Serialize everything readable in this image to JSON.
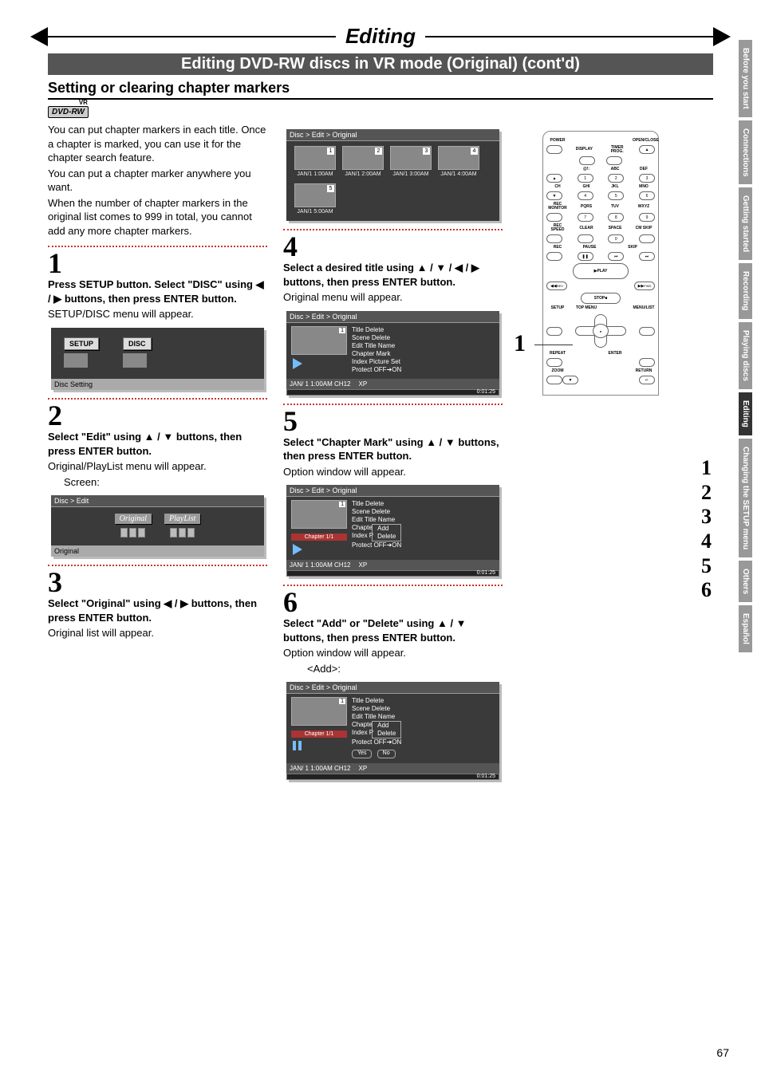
{
  "header": {
    "title": "Editing",
    "subtitle": "Editing DVD-RW discs in VR mode (Original) (cont'd)",
    "section": "Setting or clearing chapter markers",
    "badge": "DVD-RW",
    "badge_vr": "VR"
  },
  "intro": {
    "p1": "You can put chapter markers in each title. Once a chapter is marked, you can use it for the chapter search feature.",
    "p2": "You can put a chapter marker anywhere you want.",
    "p3": "When the number of chapter markers in the original list comes to 999 in total, you cannot add any more chapter markers."
  },
  "steps": {
    "s1": {
      "num": "1",
      "title": "Press SETUP button. Select \"DISC\" using ◀ / ▶ buttons, then press ENTER button.",
      "body": "SETUP/DISC menu will appear."
    },
    "s2": {
      "num": "2",
      "title": "Select \"Edit\" using ▲ / ▼ buttons, then press ENTER button.",
      "body": "Original/PlayList menu will appear.",
      "body2": "Screen:"
    },
    "s3": {
      "num": "3",
      "title": "Select \"Original\" using ◀ / ▶ buttons, then press ENTER button.",
      "body": "Original list will appear."
    },
    "s4": {
      "num": "4",
      "title": "Select a desired title using ▲ / ▼ / ◀ / ▶ buttons, then press ENTER button.",
      "body": "Original menu will appear."
    },
    "s5": {
      "num": "5",
      "title": "Select \"Chapter Mark\" using ▲ / ▼ buttons, then press ENTER button.",
      "body": "Option window will appear."
    },
    "s6": {
      "num": "6",
      "title": "Select \"Add\" or \"Delete\" using ▲ / ▼ buttons, then press ENTER button.",
      "body": "Option window will appear.",
      "body2": "<Add>:"
    }
  },
  "screens": {
    "setup": {
      "btn1": "SETUP",
      "btn2": "DISC",
      "footer": "Disc Setting"
    },
    "edit": {
      "title": "Disc > Edit",
      "opt1": "Original",
      "opt2": "PlayList",
      "footer": "Original"
    },
    "orig_list": {
      "title": "Disc > Edit > Original",
      "thumbs": [
        {
          "num": "1",
          "label": "JAN/1   1:00AM"
        },
        {
          "num": "2",
          "label": "JAN/1   2:00AM"
        },
        {
          "num": "3",
          "label": "JAN/1   3:00AM"
        },
        {
          "num": "4",
          "label": "JAN/1   4:00AM"
        },
        {
          "num": "5",
          "label": "JAN/1   5:00AM"
        }
      ]
    },
    "orig_menu": {
      "title": "Disc > Edit > Original",
      "items": [
        "Title Delete",
        "Scene Delete",
        "Edit Title Name",
        "Chapter Mark",
        "Index Picture Set",
        "Protect OFF➔ON"
      ],
      "status_date": "JAN/ 1   1:00AM  CH12",
      "status_mode": "XP",
      "time": "0:01:25",
      "thumb_num": "1"
    },
    "chapter_menu": {
      "title": "Disc > Edit > Original",
      "chapter": "Chapter 1/1",
      "items_pre": [
        "Title Delete",
        "Scene Delete",
        "Edit Title Name"
      ],
      "item_chap": "Chapte",
      "item_idx": "Index P",
      "item_prot": "Protect OFF➔ON",
      "popup": [
        "Add",
        "Delete"
      ],
      "status_date": "JAN/ 1   1:00AM  CH12",
      "status_mode": "XP",
      "time": "0:01:25",
      "thumb_num": "1"
    },
    "add_menu": {
      "title": "Disc > Edit > Original",
      "chapter": "Chapter 1/1",
      "items_pre": [
        "Title Delete",
        "Scene Delete",
        "Edit Title Name"
      ],
      "item_chap": "Chapte",
      "item_idx": "Index P",
      "item_prot": "Protect OFF➔ON",
      "popup": [
        "Add",
        "Delete"
      ],
      "yes": "Yes",
      "no": "No",
      "status_date": "JAN/ 1   1:00AM  CH12",
      "status_mode": "XP",
      "time": "0:01:25",
      "thumb_num": "1"
    }
  },
  "remote": {
    "power": "POWER",
    "openclose": "OPEN/CLOSE",
    "display": "DISPLAY",
    "timer": "TIMER PROG.",
    "row_at": "@!:",
    "abc": "ABC",
    "def": "DEF",
    "ch": "CH",
    "ghi": "GHI",
    "jkl": "JKL",
    "mno": "MNO",
    "recmon": "REC MONITOR",
    "pqrs": "PQRS",
    "tuv": "TUV",
    "wxyz": "WXYZ",
    "recspeed": "REC SPEED",
    "clear": "CLEAR",
    "space": "SPACE",
    "cmskip": "CM SKIP",
    "rec": "REC",
    "pause": "PAUSE",
    "skip": "SKIP",
    "play": "PLAY",
    "rev": "REV",
    "fwd": "FWD",
    "stop": "STOP",
    "setup": "SETUP",
    "topmenu": "TOP MENU",
    "menulist": "MENU/LIST",
    "repeat": "REPEAT",
    "enter": "ENTER",
    "zoom": "ZOOM",
    "return": "RETURN",
    "callout": "1",
    "steps_col": "1\n2\n3\n4\n5\n6"
  },
  "tabs": [
    "Before you start",
    "Connections",
    "Getting started",
    "Recording",
    "Playing discs",
    "Editing",
    "Changing the SETUP menu",
    "Others",
    "Español"
  ],
  "active_tab": 5,
  "page_number": "67"
}
